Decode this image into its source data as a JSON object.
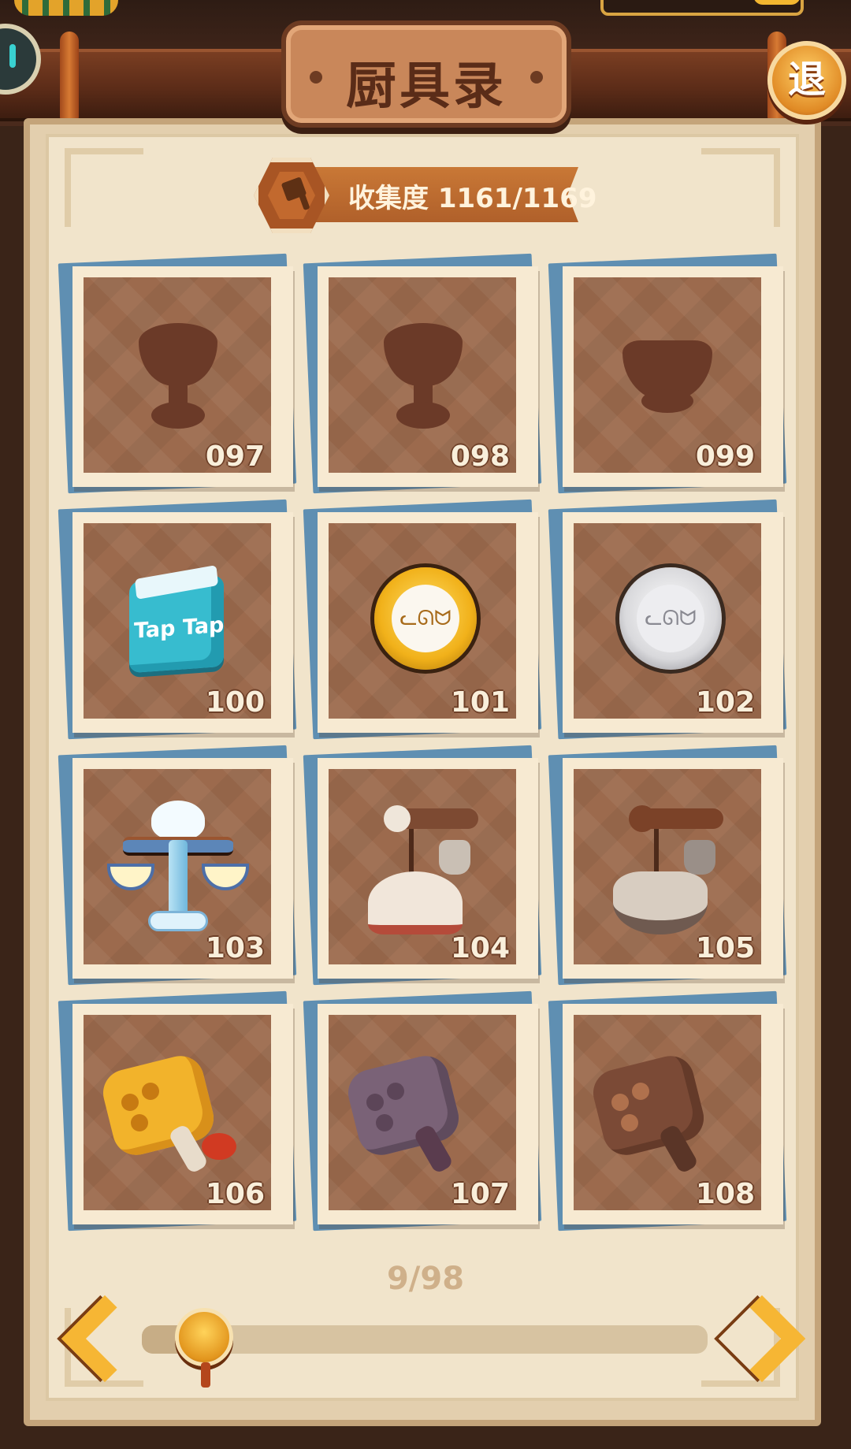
{
  "header": {
    "title": "厨具录",
    "exit_label": "退"
  },
  "collection": {
    "label": "收集度 1161/1169",
    "icon": "cleaver-icon"
  },
  "items": [
    {
      "number": "097",
      "art": "silhouette-cup",
      "state": "locked"
    },
    {
      "number": "098",
      "art": "silhouette-cup",
      "state": "locked"
    },
    {
      "number": "099",
      "art": "silhouette-bowl",
      "state": "locked"
    },
    {
      "number": "100",
      "art": "taptap-box",
      "label": "Tap Tap",
      "state": "unlocked"
    },
    {
      "number": "101",
      "art": "gold-cat-coin",
      "state": "unlocked"
    },
    {
      "number": "102",
      "art": "silver-cat-coin",
      "state": "unlocked"
    },
    {
      "number": "103",
      "art": "cloud-balance-scale",
      "state": "unlocked"
    },
    {
      "number": "104",
      "art": "steelyard-sack",
      "state": "unlocked"
    },
    {
      "number": "105",
      "art": "steelyard-basket",
      "state": "unlocked"
    },
    {
      "number": "106",
      "art": "golden-meat-hammer",
      "state": "unlocked"
    },
    {
      "number": "107",
      "art": "purple-meat-hammer",
      "state": "unlocked"
    },
    {
      "number": "108",
      "art": "brown-meat-hammer",
      "state": "unlocked"
    }
  ],
  "pagination": {
    "label": "9/98",
    "current": 9,
    "total": 98,
    "progress": 0.082
  },
  "colors": {
    "panel": "#f1e4cb",
    "card_inner": "#9c6a4d",
    "accent_gold": "#f6b634",
    "ribbon": "#c97836"
  }
}
